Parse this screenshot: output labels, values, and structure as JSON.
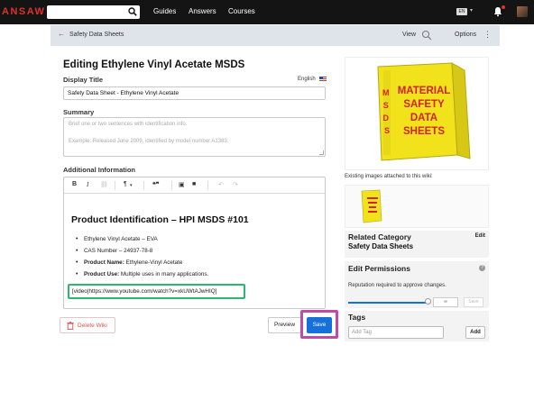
{
  "topbar": {
    "logo": "ANSAW",
    "nav": [
      "Guides",
      "Answers",
      "Courses"
    ],
    "language_badge": "EN"
  },
  "subbar": {
    "breadcrumb": "Safety Data Sheets",
    "view_label": "View",
    "options_label": "Options"
  },
  "editor": {
    "page_title": "Editing Ethylene Vinyl Acetate MSDS",
    "display_title_label": "Display Title",
    "language": "English",
    "display_title_value": "Safety Data Sheet - Ethylene Vinyl Acetate",
    "summary_label": "Summary",
    "summary_placeholder_1": "Brief one or two sentences with identification info.",
    "summary_placeholder_2": "Example: Released June 2009, identified by model number A1383.",
    "additional_label": "Additional Information",
    "toolbar": {
      "bold": "B",
      "italic": "I",
      "link": "⛓",
      "paragraph": "¶",
      "quote": "❝❞",
      "image": "▣",
      "video": "■",
      "undo": "↶",
      "redo": "↷"
    },
    "content_heading": "Product Identification – HPI MSDS #101",
    "list": {
      "item1": "Ethylene Vinyl Acetate – EVA",
      "item2": "CAS Number – 24937-78-8",
      "item3_bold": "Product Name:",
      "item3_rest": " Ethylene-Vinyl Acetate",
      "item4_bold": "Product Use:",
      "item4_rest": " Multiple uses in many applications."
    },
    "video_embed": "[video|https://www.youtube.com/watch?v=xkUWtAJwHIQ]"
  },
  "actions": {
    "delete_label": "Delete Wiki",
    "preview_label": "Preview",
    "save_label": "Save"
  },
  "sidebar": {
    "binder_lines": [
      "MATERIAL",
      "SAFETY",
      "DATA",
      "SHEETS"
    ],
    "binder_spine": "MSDS",
    "existing_images_label": "Existing images attached to this wiki:",
    "related_title": "Related Category",
    "related_value": "Safety Data Sheets",
    "related_edit": "Edit",
    "permissions_title": "Edit Permissions",
    "permissions_text": "Reputation required to approve changes.",
    "permissions_value": "∞",
    "permissions_save": "Save",
    "tags_title": "Tags",
    "tags_placeholder": "Add Tag",
    "tags_add": "Add"
  },
  "colors": {
    "accent_blue": "#1670d9",
    "highlight_green": "#2bb673",
    "highlight_magenta": "#c04aa8",
    "binder_yellow": "#f2e21c",
    "binder_red": "#d6202a"
  }
}
